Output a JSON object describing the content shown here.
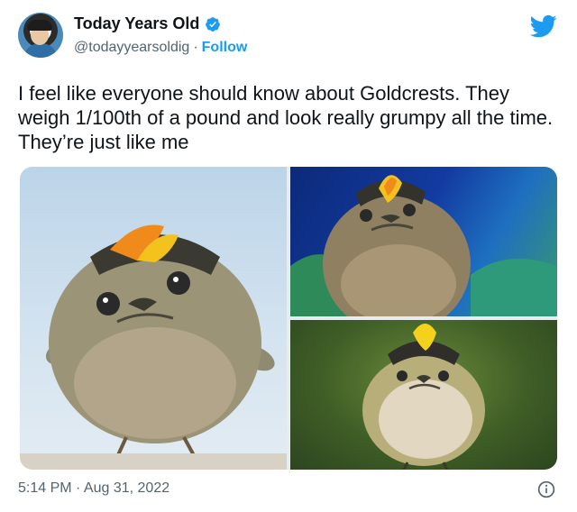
{
  "author": {
    "display_name": "Today Years Old",
    "handle": "@todayyearsoldig",
    "separator": "·",
    "follow_label": "Follow"
  },
  "tweet": {
    "text": "I feel like everyone should know about Goldcrests. They weigh 1/100th of a pound and look really grumpy all the time. They’re just like me"
  },
  "footer": {
    "timestamp": "5:14 PM · Aug 31, 2022"
  },
  "colors": {
    "accent": "#1d9bf0",
    "text_primary": "#0f1419",
    "text_secondary": "#536471"
  },
  "icons": {
    "verified": "verified-badge-icon",
    "logo": "twitter-bird-icon",
    "info": "info-icon"
  }
}
